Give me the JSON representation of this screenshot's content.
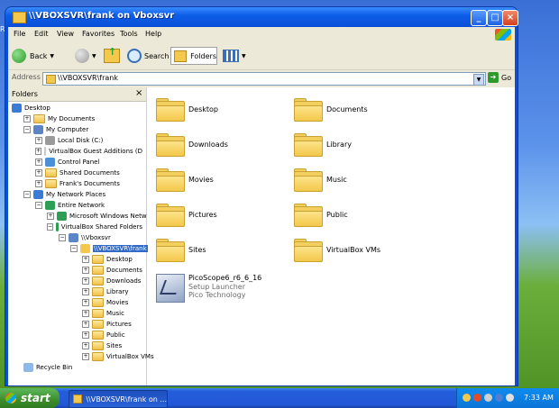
{
  "window": {
    "title": "\\\\VBOXSVR\\frank on Vboxsvr"
  },
  "menu": [
    "File",
    "Edit",
    "View",
    "Favorites",
    "Tools",
    "Help"
  ],
  "toolbar": {
    "back_label": "Back",
    "search_label": "Search",
    "folders_label": "Folders"
  },
  "address": {
    "label": "Address",
    "value": "\\\\VBOXSVR\\frank",
    "go_label": "Go"
  },
  "folders_pane": {
    "title": "Folders",
    "close_glyph": "×",
    "tree": [
      {
        "label": "Desktop",
        "level": 0,
        "exp": "",
        "icon": "desktop"
      },
      {
        "label": "My Documents",
        "level": 1,
        "exp": "+",
        "icon": "folder"
      },
      {
        "label": "My Computer",
        "level": 1,
        "exp": "−",
        "icon": "computer"
      },
      {
        "label": "Local Disk (C:)",
        "level": 2,
        "exp": "+",
        "icon": "disk"
      },
      {
        "label": "VirtualBox Guest Additions (D",
        "level": 2,
        "exp": "+",
        "icon": "cd"
      },
      {
        "label": "Control Panel",
        "level": 2,
        "exp": "+",
        "icon": "panel"
      },
      {
        "label": "Shared Documents",
        "level": 2,
        "exp": "+",
        "icon": "folder"
      },
      {
        "label": "Frank's Documents",
        "level": 2,
        "exp": "+",
        "icon": "folder"
      },
      {
        "label": "My Network Places",
        "level": 1,
        "exp": "−",
        "icon": "network"
      },
      {
        "label": "Entire Network",
        "level": 2,
        "exp": "−",
        "icon": "globe"
      },
      {
        "label": "Microsoft Windows Netw",
        "level": 3,
        "exp": "+",
        "icon": "globe"
      },
      {
        "label": "VirtualBox Shared Folders",
        "level": 3,
        "exp": "−",
        "icon": "globe"
      },
      {
        "label": "\\\\Vboxsvr",
        "level": 4,
        "exp": "−",
        "icon": "computer"
      },
      {
        "label": "\\\\VBOXSVR\\frank",
        "level": 5,
        "exp": "−",
        "icon": "share",
        "selected": true
      },
      {
        "label": "Desktop",
        "level": 6,
        "exp": "+",
        "icon": "folder"
      },
      {
        "label": "Documents",
        "level": 6,
        "exp": "+",
        "icon": "folder"
      },
      {
        "label": "Downloads",
        "level": 6,
        "exp": "+",
        "icon": "folder"
      },
      {
        "label": "Library",
        "level": 6,
        "exp": "+",
        "icon": "folder"
      },
      {
        "label": "Movies",
        "level": 6,
        "exp": "+",
        "icon": "folder"
      },
      {
        "label": "Music",
        "level": 6,
        "exp": "+",
        "icon": "folder"
      },
      {
        "label": "Pictures",
        "level": 6,
        "exp": "+",
        "icon": "folder"
      },
      {
        "label": "Public",
        "level": 6,
        "exp": "+",
        "icon": "folder"
      },
      {
        "label": "Sites",
        "level": 6,
        "exp": "+",
        "icon": "folder"
      },
      {
        "label": "VirtualBox VMs",
        "level": 6,
        "exp": "+",
        "icon": "folder"
      },
      {
        "label": "Recycle Bin",
        "level": 1,
        "exp": "",
        "icon": "bin"
      }
    ]
  },
  "files": [
    {
      "name": "Desktop"
    },
    {
      "name": "Documents"
    },
    {
      "name": "Downloads"
    },
    {
      "name": "Library"
    },
    {
      "name": "Movies"
    },
    {
      "name": "Music"
    },
    {
      "name": "Pictures"
    },
    {
      "name": "Public"
    },
    {
      "name": "Sites"
    },
    {
      "name": "VirtualBox VMs"
    }
  ],
  "app_item": {
    "name": "PicoScope6_r6_6_16",
    "type": "Setup Launcher",
    "company": "Pico Technology"
  },
  "taskbar": {
    "start_label": "start",
    "task_label": "\\\\VBOXSVR\\frank on ...",
    "clock": "7:33 AM"
  },
  "desktop_fragment": "Re"
}
